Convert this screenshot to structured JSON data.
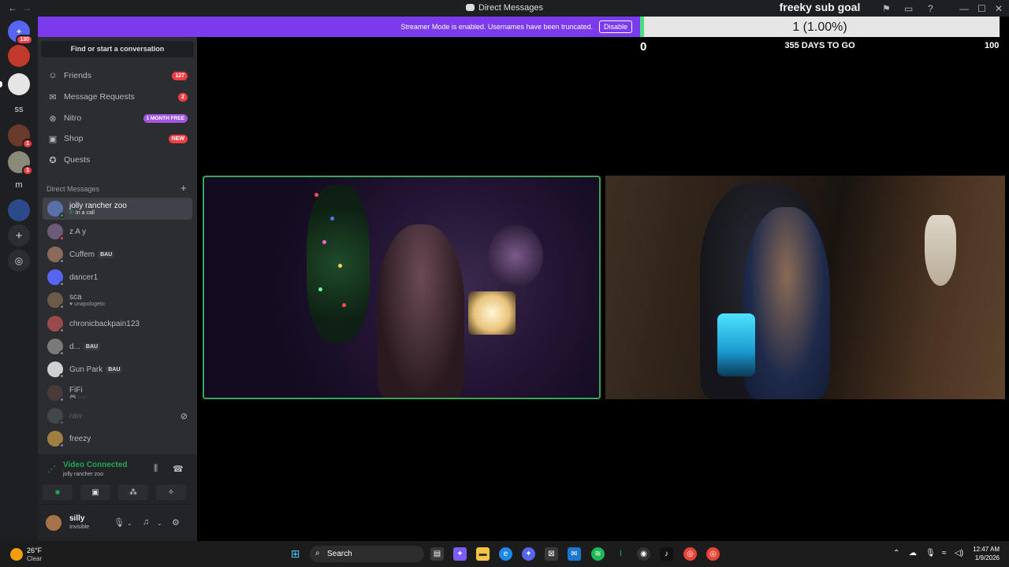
{
  "window": {
    "title": "Direct Messages"
  },
  "banner": {
    "message": "Streamer Mode is enabled. Usernames have been truncated.",
    "button": "Disable"
  },
  "goal": {
    "title": "freeky sub goal",
    "percent_label": "1 (1.00%)",
    "progress": 0.01,
    "start": "0",
    "days_left": "355 DAYS TO GO",
    "target": "100"
  },
  "servers": [
    {
      "icon": "discord-home-icon",
      "badge": "130"
    },
    {
      "icon": "server-avatar-icon"
    },
    {
      "icon": "server-avatar-icon"
    },
    {
      "label": "ss"
    },
    {
      "icon": "server-avatar-icon",
      "badge": "1"
    },
    {
      "icon": "server-avatar-icon",
      "badge": "1"
    },
    {
      "label": "m"
    },
    {
      "icon": "server-avatar-icon"
    },
    {
      "icon": "add-server-icon"
    },
    {
      "icon": "discover-icon"
    }
  ],
  "sidebar": {
    "search_label": "Find or start a conversation",
    "nav": [
      {
        "label": "Friends",
        "badge": "127",
        "icon": "friends-icon"
      },
      {
        "label": "Message Requests",
        "badge": "2",
        "icon": "mail-icon"
      },
      {
        "label": "Nitro",
        "pill": "1 MONTH FREE",
        "icon": "nitro-icon"
      },
      {
        "label": "Shop",
        "pill": "NEW",
        "icon": "shop-icon"
      },
      {
        "label": "Quests",
        "icon": "quests-icon"
      }
    ],
    "dm_header": "Direct Messages",
    "dms": [
      {
        "name": "jolly rancher zoo",
        "sub": "In a call",
        "color": "#5b6fa8"
      },
      {
        "name": "z A y",
        "sub": "",
        "color": "#6d5b7a"
      },
      {
        "name": "Cuffem",
        "tag": "BAU",
        "sub": "",
        "color": "#8a6a5a"
      },
      {
        "name": "dancer1",
        "sub": "",
        "color": "#5865f2"
      },
      {
        "name": "sca",
        "sub": "unapologetic",
        "color": "#6b5a4a"
      },
      {
        "name": "chronicbackpain123",
        "sub": "",
        "color": "#9a4a4a"
      },
      {
        "name": "d...",
        "tag": "BAU",
        "sub": "",
        "color": "#7a7a7a"
      },
      {
        "name": "Gun Park",
        "tag": "BAU",
        "sub": "",
        "color": "#d0d0d0"
      },
      {
        "name": "FiFi",
        "sub": "",
        "color": "#4a3a3a"
      },
      {
        "name": "raw",
        "sub": "",
        "color": "#5c5f66"
      },
      {
        "name": "freezy",
        "sub": "",
        "color": "#a08040"
      }
    ]
  },
  "voice": {
    "status": "Video Connected",
    "channel": "jolly rancher zoo"
  },
  "user": {
    "name": "silly",
    "status": "Invisible"
  },
  "taskbar": {
    "temp": "26°F",
    "condition": "Clear",
    "search": "Search",
    "time": "12:47 AM",
    "date": "1/9/2026"
  }
}
